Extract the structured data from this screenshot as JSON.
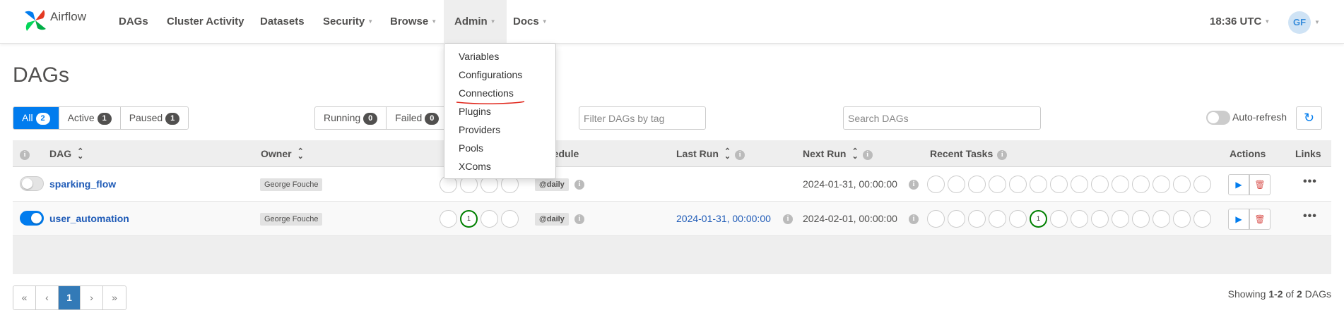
{
  "nav": {
    "brand": "Airflow",
    "items": [
      "DAGs",
      "Cluster Activity",
      "Datasets",
      "Security",
      "Browse",
      "Admin",
      "Docs"
    ],
    "time": "18:36 UTC",
    "user_initials": "GF"
  },
  "admin_menu": [
    "Variables",
    "Configurations",
    "Connections",
    "Plugins",
    "Providers",
    "Pools",
    "XComs"
  ],
  "page": {
    "title": "DAGs"
  },
  "filters": {
    "all_label": "All",
    "all_count": "2",
    "active_label": "Active",
    "active_count": "1",
    "paused_label": "Paused",
    "paused_count": "1",
    "running_label": "Running",
    "running_count": "0",
    "failed_label": "Failed",
    "failed_count": "0",
    "tag_placeholder": "Filter DAGs by tag",
    "search_placeholder": "Search DAGs",
    "autorefresh_label": "Auto-refresh"
  },
  "table": {
    "columns": {
      "dag": "DAG",
      "owner": "Owner",
      "schedule": "Schedule",
      "last_run": "Last Run",
      "next_run": "Next Run",
      "recent_tasks": "Recent Tasks",
      "actions": "Actions",
      "links": "Links"
    },
    "rows": [
      {
        "dag_id": "sparking_flow",
        "paused": true,
        "owner": "George Fouche",
        "run_counts": [
          "",
          "",
          "",
          ""
        ],
        "schedule": "@daily",
        "last_run": "",
        "next_run": "2024-01-31, 00:00:00",
        "task_counts": [
          "",
          "",
          "",
          "",
          "",
          "",
          "",
          "",
          "",
          "",
          "",
          "",
          "",
          ""
        ]
      },
      {
        "dag_id": "user_automation",
        "paused": false,
        "owner": "George Fouche",
        "run_counts": [
          "",
          "1",
          "",
          ""
        ],
        "schedule": "@daily",
        "last_run": "2024-01-31, 00:00:00",
        "next_run": "2024-02-01, 00:00:00",
        "task_counts": [
          "",
          "",
          "",
          "",
          "",
          "1",
          "",
          "",
          "",
          "",
          "",
          "",
          "",
          ""
        ]
      }
    ],
    "links_glyph": "•••"
  },
  "pagination": {
    "first": "«",
    "prev": "‹",
    "current": "1",
    "next": "›",
    "last": "»"
  },
  "showing": {
    "prefix": "Showing",
    "range": "1-2",
    "of": "of",
    "total": "2",
    "suffix": "DAGs"
  },
  "colors": {
    "accent": "#017cee",
    "success": "#008000",
    "link": "#1f5bb7",
    "annotation": "#e0261b"
  },
  "icons": [
    "airflow-logo-icon",
    "info-icon",
    "sort-icon",
    "play-icon",
    "trash-icon",
    "refresh-icon",
    "more-icon"
  ]
}
